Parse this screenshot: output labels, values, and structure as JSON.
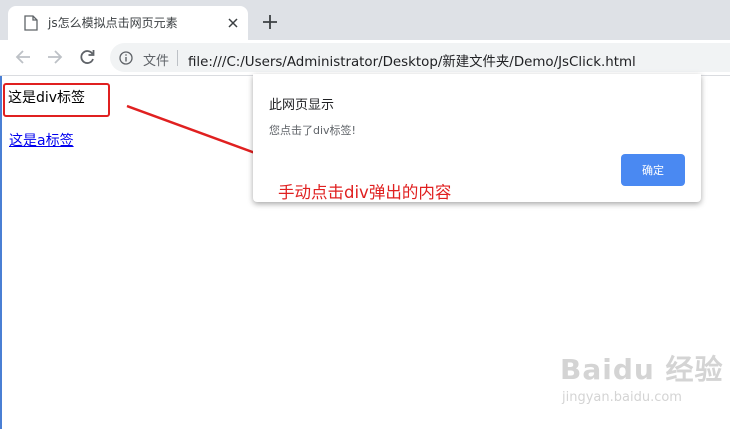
{
  "browser": {
    "tab_title": "js怎么模拟点击网页元素",
    "security_label": "文件",
    "url": "file:///C:/Users/Administrator/Desktop/新建文件夹/Demo/JsClick.html"
  },
  "page": {
    "div_text": "这是div标签",
    "link_text": "这是a标签"
  },
  "dialog": {
    "title": "此网页显示",
    "message": "您点击了div标签!",
    "ok_label": "确定"
  },
  "annotation": {
    "text": "手动点击div弹出的内容",
    "color": "#e02020"
  },
  "watermark": {
    "logo": "Baidu 经验",
    "url": "jingyan.baidu.com"
  },
  "colors": {
    "accent_button": "#4a89f2",
    "link": "#0000ee",
    "tabstrip": "#dee1e6"
  },
  "icons": [
    "page-icon",
    "close-icon",
    "plus-icon",
    "back-arrow-icon",
    "forward-arrow-icon",
    "reload-icon",
    "info-icon",
    "red-arrow-icon"
  ]
}
